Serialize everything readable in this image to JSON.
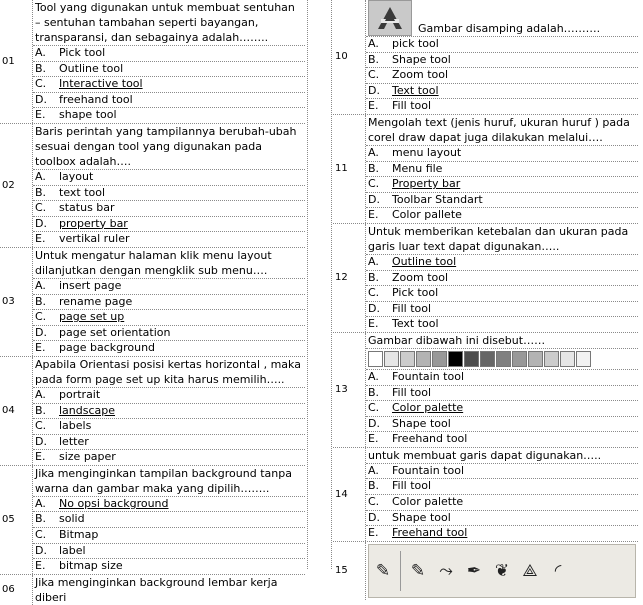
{
  "questions": [
    {
      "num": "01",
      "text": "Tool yang  digunakan untuk  membuat sentuhan – sentuhan  tambahan seperti  bayangan, transparansi,  dan sebagainya adalah……..",
      "options": [
        {
          "l": "A.",
          "t": "Pick tool"
        },
        {
          "l": "B.",
          "t": "Outline tool"
        },
        {
          "l": "C.",
          "t": "Interactive tool"
        },
        {
          "l": "D.",
          "t": "freehand tool"
        },
        {
          "l": "E.",
          "t": "shape tool"
        }
      ]
    },
    {
      "num": "02",
      "text": "Baris perintah yang tampilannya berubah-ubah sesuai dengan tool yang digunakan pada toolbox adalah….",
      "options": [
        {
          "l": "A.",
          "t": "layout"
        },
        {
          "l": "B.",
          "t": "text tool"
        },
        {
          "l": "C.",
          "t": "status bar"
        },
        {
          "l": "D.",
          "t": "property bar"
        },
        {
          "l": "E.",
          "t": "vertikal ruler"
        }
      ]
    },
    {
      "num": "03",
      "text": "Untuk mengatur halaman klik menu layout dilanjutkan dengan mengklik  sub menu….",
      "options": [
        {
          "l": "A.",
          "t": "insert page"
        },
        {
          "l": "B.",
          "t": "rename page"
        },
        {
          "l": "C.",
          "t": "page set up"
        },
        {
          "l": "D.",
          "t": "page set orientation"
        },
        {
          "l": "E.",
          "t": "page background"
        }
      ]
    },
    {
      "num": "04",
      "text": "Apabila Orientasi posisi kertas horizontal , maka pada form page set up  kita harus memilih…..",
      "options": [
        {
          "l": "A.",
          "t": "portrait"
        },
        {
          "l": "B.",
          "t": "landscape"
        },
        {
          "l": "C.",
          "t": "labels"
        },
        {
          "l": "D.",
          "t": "letter"
        },
        {
          "l": "E.",
          "t": "size paper"
        }
      ]
    },
    {
      "num": "05",
      "text": "Jika menginginkan  tampilan background tanpa warna dan gambar maka yang dipilih……..",
      "options": [
        {
          "l": "A.",
          "t": "No opsi background"
        },
        {
          "l": "B.",
          "t": "solid"
        },
        {
          "l": "C.",
          "t": "Bitmap"
        },
        {
          "l": "D.",
          "t": "label"
        },
        {
          "l": "E.",
          "t": "bitmap size"
        }
      ]
    },
    {
      "num": "06",
      "text": "Jika menginginkan background lembar kerja diberi"
    },
    {
      "num": "10",
      "text": "Gambar disamping adalah……….",
      "options": [
        {
          "l": "A.",
          "t": "pick tool"
        },
        {
          "l": "B.",
          "t": "Shape tool"
        },
        {
          "l": "C.",
          "t": "Zoom tool"
        },
        {
          "l": "D.",
          "t": "Text tool"
        },
        {
          "l": "E.",
          "t": "Fill tool"
        }
      ]
    },
    {
      "num": "11",
      "text": "Mengolah text (jenis huruf, ukuran huruf ) pada corel draw dapat juga dilakukan melalui….",
      "options": [
        {
          "l": "A.",
          "t": "menu layout"
        },
        {
          "l": "B.",
          "t": "Menu file"
        },
        {
          "l": "C.",
          "t": "Property bar"
        },
        {
          "l": "D.",
          "t": "Toolbar Standart"
        },
        {
          "l": "E.",
          "t": "Color pallete"
        }
      ]
    },
    {
      "num": "12",
      "text": "Untuk memberikan ketebalan dan ukuran  pada garis luar text dapat digunakan…..",
      "options": [
        {
          "l": "A.",
          "t": "Outline tool"
        },
        {
          "l": "B.",
          "t": "Zoom tool"
        },
        {
          "l": "C.",
          "t": "Pick tool"
        },
        {
          "l": "D.",
          "t": "Fill tool"
        },
        {
          "l": "E.",
          "t": "Text tool"
        }
      ]
    },
    {
      "num": "13",
      "text": "Gambar dibawah ini disebut……",
      "options": [
        {
          "l": "A.",
          "t": "Fountain tool"
        },
        {
          "l": "B.",
          "t": "Fill tool"
        },
        {
          "l": "C.",
          "t": "Color palette"
        },
        {
          "l": "D.",
          "t": "Shape tool"
        },
        {
          "l": "E.",
          "t": "Freehand tool"
        }
      ]
    },
    {
      "num": "14",
      "text": "untuk membuat garis  dapat digunakan…..",
      "options": [
        {
          "l": "A.",
          "t": "Fountain tool"
        },
        {
          "l": "B.",
          "t": "Fill tool"
        },
        {
          "l": "C.",
          "t": "Color palette"
        },
        {
          "l": "D.",
          "t": "Shape tool"
        },
        {
          "l": "E.",
          "t": "Freehand tool"
        }
      ]
    },
    {
      "num": "15"
    }
  ],
  "palette_colors": [
    "#ffffff",
    "#e6e6e6",
    "#cccccc",
    "#b3b3b3",
    "#999999",
    "#000000",
    "#4d4d4d",
    "#666666",
    "#808080",
    "#999999",
    "#b3b3b3",
    "#cccccc",
    "#e6e6e6",
    "#f2f2f2"
  ],
  "icons": {
    "q10": "text-tool-icon",
    "q15_toolbar": [
      "freehand-pen-icon",
      "bezier-node-icon",
      "pen-icon",
      "brush-icon",
      "smart-draw-icon",
      "dimension-icon"
    ]
  }
}
